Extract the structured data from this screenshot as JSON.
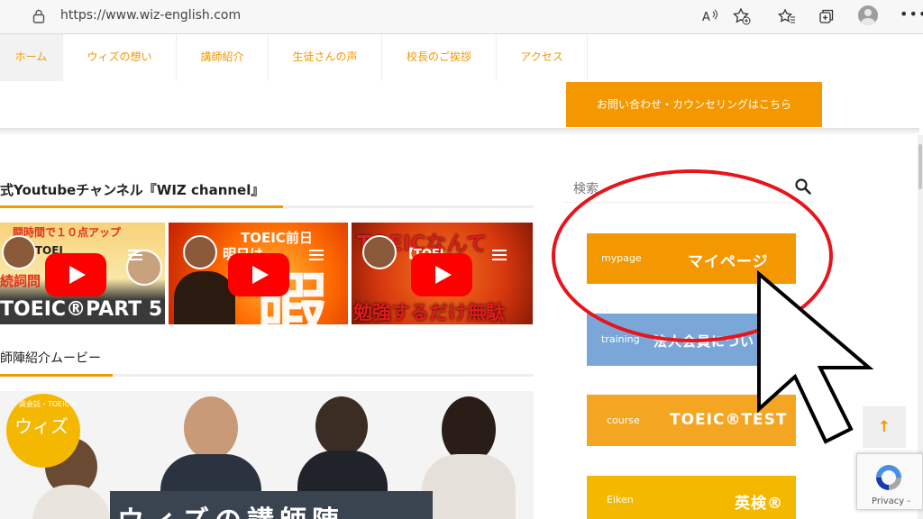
{
  "browser": {
    "url": "https://www.wiz-english.com",
    "icons": [
      "lock-icon",
      "read-aloud-icon",
      "favorite-add-icon",
      "favorites-icon",
      "collections-icon",
      "profile-icon",
      "more-icon"
    ]
  },
  "nav": {
    "items": [
      {
        "label": "ホーム",
        "active": true
      },
      {
        "label": "ウィズの想い",
        "active": false
      },
      {
        "label": "講師紹介",
        "active": false
      },
      {
        "label": "生徒さんの声",
        "active": false
      },
      {
        "label": "校長のご挨拶",
        "active": false
      },
      {
        "label": "アクセス",
        "active": false
      }
    ],
    "contact_label": "お問い合わせ・カウンセリングはこちら"
  },
  "main": {
    "channel_title": "式Youtubeチャンネル『WIZ channel』",
    "videos": [
      {
        "top_text": "闘時間で１０点アップ",
        "mid_text": "C®【TOEI",
        "left_text": "続詞問",
        "bottom_text": "TOEIC®PART 5"
      },
      {
        "top_text": "TOEIC前日",
        "mid_text": "明日は",
        "big_text": "暇"
      },
      {
        "top_text": "TOEICなんて",
        "mid_text": "【TOEI",
        "bottom_text": "勉強するだけ無駄"
      }
    ],
    "teachers_title": "師陣紹介ムービー",
    "movie": {
      "circle_small": "英会話・TOEIC®",
      "circle_big": "ウィズ",
      "banner_text": "ウィズの講師陣"
    }
  },
  "sidebar": {
    "search_placeholder": "検索",
    "cards": [
      {
        "en": "mypage",
        "jp": "マイページ",
        "color": "#f39800"
      },
      {
        "en": "training",
        "jp": "法人会員につい",
        "color": "#7aa7d8"
      },
      {
        "en": "course",
        "jp": "TOEIC®TEST",
        "color": "#f4a623"
      },
      {
        "en": "Eiken",
        "jp": "英検®",
        "color": "#f5b800"
      }
    ]
  },
  "widgets": {
    "back_to_top": "↑",
    "recaptcha_label": "Privacy -"
  },
  "colors": {
    "accent": "#f39800",
    "highlight": "#e8141b"
  }
}
